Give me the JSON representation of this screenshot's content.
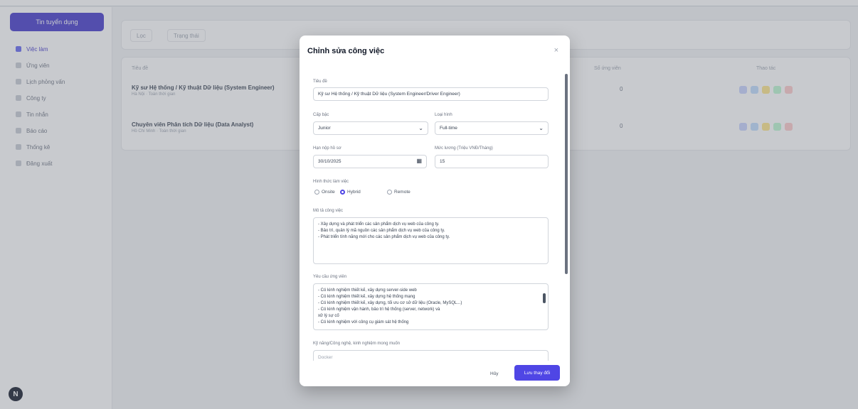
{
  "sidebar": {
    "primary_button": "Tin tuyển dụng",
    "items": [
      {
        "label": "Việc làm"
      },
      {
        "label": "Ứng viên"
      },
      {
        "label": "Lịch phỏng vấn"
      },
      {
        "label": "Công ty"
      },
      {
        "label": "Tin nhắn"
      },
      {
        "label": "Báo cáo"
      },
      {
        "label": "Thống kê"
      },
      {
        "label": "Đăng xuất"
      }
    ],
    "help_label": "N"
  },
  "background": {
    "filters": [
      "Lọc",
      "Trạng thái"
    ],
    "columns": [
      "Tiêu đề",
      "Số ứng viên",
      "Thao tác"
    ],
    "rows": [
      {
        "title": "Kỹ sư Hệ thống / Kỹ thuật Dữ liệu (System Engineer)",
        "sub": "Hà Nội · Toàn thời gian",
        "count": "0"
      },
      {
        "title": "Chuyên viên Phân tích Dữ liệu (Data Analyst)",
        "sub": "Hồ Chí Minh · Toàn thời gian",
        "count": "0"
      }
    ],
    "action_colors": [
      "#c7d2fe",
      "#bfdbfe",
      "#fde68a",
      "#bbf7d0",
      "#fecaca"
    ]
  },
  "modal": {
    "title": "Chỉnh sửa công việc",
    "close_icon": "×",
    "fields": {
      "title_label": "Tiêu đề",
      "title_value": "Kỹ sư Hệ thống / Kỹ thuật Dữ liệu (System Engineer/Driver Engineer)",
      "level_label": "Cấp bậc",
      "level_value": "Junior",
      "type_label": "Loại hình",
      "type_value": "Full-time",
      "deadline_label": "Hạn nộp hồ sơ",
      "deadline_value": "30/10/2025",
      "salary_label": "Mức lương (Triệu VNĐ/Tháng)",
      "salary_value": "15",
      "workmode_label": "Hình thức làm việc",
      "workmode_options": [
        "Onsite",
        "Hybrid",
        "Remote"
      ],
      "workmode_selected": "Hybrid",
      "description_label": "Mô tả công việc",
      "description_lines": [
        "- Xây dựng và phát triển các sản phẩm dịch vụ web của công ty.",
        "- Bảo trì, quản lý mã nguồn các sản phẩm dịch vụ web của công ty.",
        "- Phát triển tính năng mới cho các sản phẩm dịch vụ web của công ty."
      ],
      "requirements_label": "Yêu cầu ứng viên",
      "requirements_lines": [
        "- Có kinh nghiệm thiết kế, xây dựng server-side web",
        "- Có kinh nghiệm thiết kế, xây dựng hệ thống mạng",
        "- Có kinh nghiệm thiết kế, xây dựng, tối ưu cơ sở dữ liệu (Oracle, MySQL...)",
        "- Có kinh nghiệm vận hành, bảo trì hệ thống (server, network) và",
        "  xử lý sự cố",
        "- Có kinh nghiệm với công cụ giám sát hệ thống"
      ],
      "benefits_label": "Kỹ năng/Công nghệ, kinh nghiệm mong muốn",
      "benefits_value": "Docker"
    },
    "cancel_label": "Hủy",
    "save_label": "Lưu thay đổi"
  },
  "colors": {
    "accent": "#4f46e5",
    "sidebar_primary": "#4338ca"
  }
}
